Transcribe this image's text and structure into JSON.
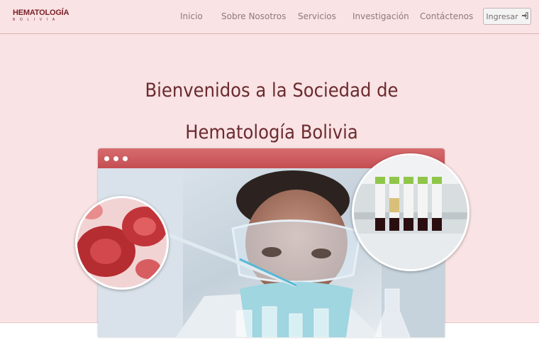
{
  "brand": {
    "name": "HEMATOLOGÍA",
    "subtitle": "BOLIVIA"
  },
  "nav": {
    "items": [
      "Inicio",
      "Sobre Nosotros",
      "Servicios",
      "Investigación",
      "Contáctenos"
    ],
    "login_label": "Ingresar",
    "login_icon": "sign-in-icon"
  },
  "hero": {
    "title_line1": "Bienvenidos a la Sociedad de",
    "title_line2": "Hematología Bolivia"
  },
  "colors": {
    "accent": "#c44f53",
    "background": "#f9e3e4",
    "heading": "#6b2b2f"
  }
}
